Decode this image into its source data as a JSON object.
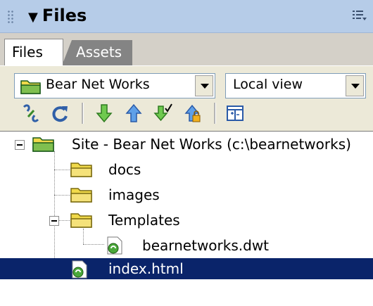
{
  "panel": {
    "title": "Files",
    "collapse_glyph": "▼"
  },
  "tabs": [
    {
      "label": "Files",
      "active": true
    },
    {
      "label": "Assets",
      "active": false
    }
  ],
  "toolbar": {
    "site_select": "Bear Net Works",
    "view_select": "Local view",
    "buttons": [
      "connect-icon",
      "refresh-icon",
      "get-files-icon",
      "put-files-icon",
      "check-out-icon",
      "check-in-icon",
      "expand-collapse-icon"
    ]
  },
  "tree": {
    "root": "Site - Bear Net Works (c:\\bearnetworks)",
    "items": [
      {
        "label": "docs",
        "type": "folder"
      },
      {
        "label": "images",
        "type": "folder"
      },
      {
        "label": "Templates",
        "type": "folder"
      },
      {
        "label": "bearnetworks.dwt",
        "type": "file"
      },
      {
        "label": "index.html",
        "type": "file",
        "selected": true
      }
    ]
  },
  "colors": {
    "title_bar": "#b6cce8",
    "selection": "#0a246a",
    "tab_inactive": "#848484"
  }
}
